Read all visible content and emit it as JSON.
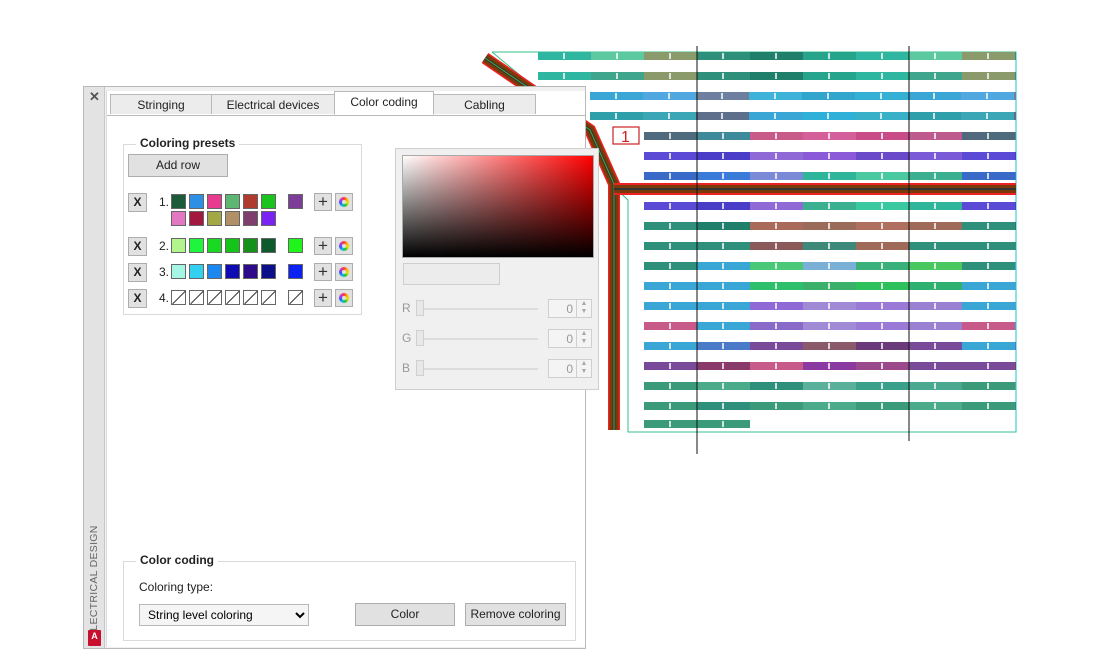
{
  "palette": {
    "side_title": "ELECTRICAL DESIGN",
    "close_label": "✕",
    "app_badge": "A",
    "tabs": [
      {
        "label": "Stringing",
        "active": false
      },
      {
        "label": "Electrical devices",
        "active": false
      },
      {
        "label": "Color coding",
        "active": true
      },
      {
        "label": "Cabling",
        "active": false
      }
    ],
    "presets": {
      "title": "Coloring presets",
      "add_row_label": "Add row",
      "remove_label": "X",
      "plus_label": "+",
      "rows": [
        {
          "number": "1.",
          "colors": [
            "#1d5a3a",
            "#2e8fe6",
            "#e83a8f",
            "#5db672",
            "#b03a2e",
            "#19c41e",
            "#e377c2",
            "#a3183f",
            "#a3a847",
            "#b09066",
            "#7e3f6e",
            "#7a22f2"
          ],
          "selected": "#7d3c98"
        },
        {
          "number": "2.",
          "colors": [
            "#b2f58c",
            "#1ff53d",
            "#1ad923",
            "#15c418",
            "#16921a",
            "#0d5b2d"
          ],
          "selected": "#1ff51a"
        },
        {
          "number": "3.",
          "colors": [
            "#a6f6e6",
            "#33d0f0",
            "#1b87f1",
            "#0e0bb2",
            "#2e0b88",
            "#0c0f8a"
          ],
          "selected": "#0c22f5"
        },
        {
          "number": "4.",
          "colors": [
            "none",
            "none",
            "none",
            "none",
            "none",
            "none"
          ],
          "selected": "none"
        }
      ]
    },
    "picker": {
      "r_label": "R",
      "g_label": "G",
      "b_label": "B",
      "r_value": "0",
      "g_value": "0",
      "b_value": "0"
    },
    "coding": {
      "title": "Color coding",
      "type_label": "Coloring type:",
      "type_value": "String level coloring",
      "color_button": "Color",
      "remove_button": "Remove coloring"
    }
  },
  "cad": {
    "label": "1",
    "row_palettes": [
      [
        "#2fb6a0",
        "#5dc9a1",
        "#8a9a6a",
        "#2e8f7a",
        "#1f7f6a",
        "#27a58c"
      ],
      [
        "#2fb6a0",
        "#3fa58c",
        "#8a9a6a",
        "#2e8f7a",
        "#1f7f6a",
        "#27a58c"
      ],
      [
        "#3aa6d6",
        "#4fa8e0",
        "#6e7fa0",
        "#3db3d9",
        "#31a5cc",
        "#35b0d5"
      ],
      [
        "#2f9faa",
        "#3aa6b6",
        "#5d6f8a",
        "#3aa6d6",
        "#2fb0d9",
        "#38b0c8"
      ],
      [
        "#4e6a7c",
        "#3e8a9a",
        "#c85a8a",
        "#d45f9a",
        "#c84c88",
        "#bf5a8f"
      ],
      [
        "#5a4ad6",
        "#4a3ec8",
        "#8f6ad6",
        "#8a5ad8",
        "#6a4ac8",
        "#7a5ad6"
      ],
      [
        "#3a6ac8",
        "#3a7ad8",
        "#7a8ad6",
        "#2fb69a",
        "#4ac8a0",
        "#3ab090"
      ],
      [
        "#5a4ad6",
        "#4a3ec8",
        "#8f6ad6",
        "#3ab090",
        "#3ac8a0",
        "#2fb69a"
      ],
      [
        "#2e8f7a",
        "#1f7f6a",
        "#aa6a5a",
        "#9a6a5a",
        "#b07060",
        "#a06a58"
      ],
      [
        "#2e8f7a",
        "#2e8f7a",
        "#8a5a5a",
        "#3e8a7a",
        "#a06a58",
        "#2e8f7a"
      ],
      [
        "#2e8f7a",
        "#3aa6d6",
        "#4ac878",
        "#7ab0d6",
        "#3ab07a",
        "#4ac860"
      ],
      [
        "#3aa6d6",
        "#3aa6d6",
        "#2ebf6a",
        "#3ab06a",
        "#2ec05a",
        "#2fb070"
      ],
      [
        "#3aa6d6",
        "#3aa6d6",
        "#8f6ad6",
        "#a08ad6",
        "#9a7ad6",
        "#9a80d0"
      ],
      [
        "#c85a8a",
        "#3aa6d6",
        "#8a6ac8",
        "#a08ad6",
        "#9a7ad6",
        "#9a80d0"
      ],
      [
        "#3aa6d6",
        "#4a7ac8",
        "#7a4a9a",
        "#8a5a6a",
        "#6a3a7a",
        "#7a4a9a"
      ],
      [
        "#7a4a9a",
        "#8a3a6a",
        "#c85a8a",
        "#8a3aa0",
        "#9a4a8a",
        "#7a4a9a"
      ],
      [
        "#3a9a7a",
        "#4aaa8a",
        "#2e8f7a",
        "#5ab09a",
        "#3aa08a",
        "#4aa890"
      ],
      [
        "#3a9a7a",
        "#2e8f7a",
        "#3a9a7a",
        "#4aaa8a",
        "#3a9a7a",
        "#4aaa8a"
      ],
      [
        "#3a9a7a"
      ]
    ]
  }
}
